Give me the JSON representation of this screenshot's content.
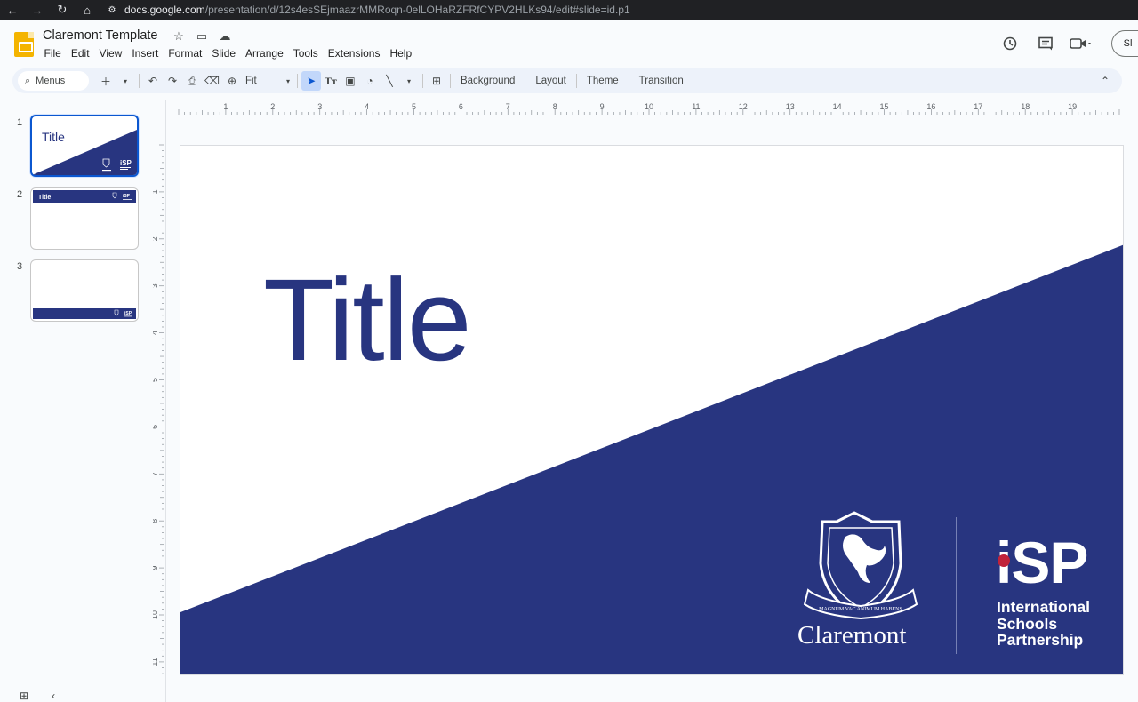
{
  "browser": {
    "url_host": "docs.google.com",
    "url_path": "/presentation/d/12s4esSEjmaazrMMRoqn-0elLOHaRZFRfCYPV2HLKs94/edit#slide=id.p1"
  },
  "app": {
    "doc_title": "Claremont Template",
    "menu": [
      "File",
      "Edit",
      "View",
      "Insert",
      "Format",
      "Slide",
      "Arrange",
      "Tools",
      "Extensions",
      "Help"
    ],
    "share_label": "Sl"
  },
  "toolbar": {
    "search_label": "Menus",
    "zoom_label": "Fit",
    "background_label": "Background",
    "layout_label": "Layout",
    "theme_label": "Theme",
    "transition_label": "Transition"
  },
  "filmstrip": {
    "slides": [
      {
        "number": "1",
        "title": "Title",
        "active": true
      },
      {
        "number": "2",
        "title": "Title",
        "active": false
      },
      {
        "number": "3",
        "title": "",
        "active": false
      }
    ]
  },
  "rulers": {
    "top_labels": [
      "1",
      "2",
      "3",
      "4",
      "5",
      "6",
      "7",
      "8",
      "9",
      "10",
      "11",
      "12",
      "13",
      "14",
      "15",
      "16",
      "17",
      "18",
      "19"
    ],
    "left_labels": [
      "1",
      "2",
      "3",
      "4",
      "5",
      "6",
      "7",
      "8",
      "9",
      "10",
      "11"
    ]
  },
  "slide": {
    "title": "Title",
    "claremont_wordmark": "Claremont",
    "crest_motto": "MAGNUM VAC ANIMUM HABENS",
    "isp_mark": "iSP",
    "isp_lines": [
      "International",
      "Schools",
      "Partnership"
    ],
    "colors": {
      "navy": "#283580",
      "isp_dot": "#c0223a"
    }
  }
}
